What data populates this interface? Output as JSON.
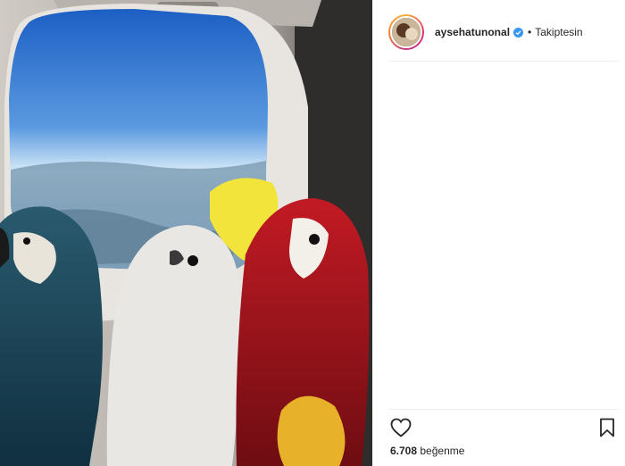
{
  "header": {
    "username": "aysehatunonal",
    "separator": "•",
    "follow_label": "Takiptesin"
  },
  "icons": {
    "avatar": "profile-photo",
    "verified": "verified-badge-icon",
    "like": "heart-icon",
    "save": "bookmark-icon"
  },
  "colors": {
    "verified_blue": "#3897f0",
    "text": "#262626",
    "divider": "#efefef"
  },
  "likes": {
    "count": "6.708",
    "label": "beğenme"
  }
}
